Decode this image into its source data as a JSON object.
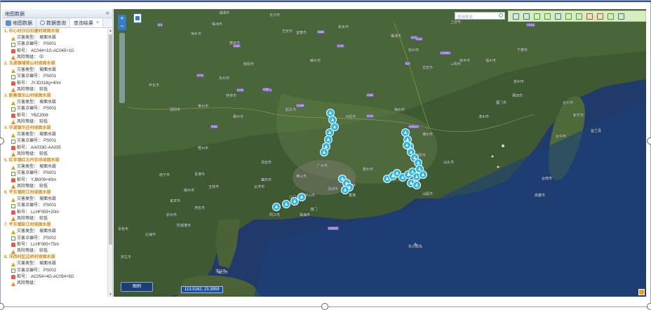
{
  "panel": {
    "title": "地图数据",
    "collapse_glyph": "«",
    "tabs": [
      {
        "label": "地图数据",
        "icon": "map-icon"
      },
      {
        "label": "数据查询",
        "icon": "search-icon"
      },
      {
        "label": "查询结果",
        "close": "×"
      }
    ],
    "results": [
      {
        "title": "1. 中心村沙白石塘村坡面水毁",
        "type_label": "灾害类型：",
        "type": "坡面水毁",
        "no_label": "灾害点编号：",
        "no": "PS001",
        "pile_label": "桩号：",
        "pile": "AC044+1G-AC045+1G",
        "risk_label": "风险等级：",
        "risk": "中"
      },
      {
        "title": "2. 玉湖镇埔背山村坡面水毁",
        "type_label": "灾害类型：",
        "type": "坡面水毁",
        "no_label": "灾害点编号：",
        "no": "PS001",
        "pile_label": "桩号：",
        "pile": "JYJD318g+40m",
        "risk_label": "风险等级：",
        "risk": "较低"
      },
      {
        "title": "3. 新蕉镇东山村坡面水毁",
        "type_label": "灾害类型：",
        "type": "坡面水毁",
        "no_label": "灾害点编号：",
        "no": "PS001",
        "pile_label": "桩号：",
        "pile": "YBZJ006",
        "risk_label": "风险等级：",
        "risk": "较低"
      },
      {
        "title": "4. 华湖镇华庄村坡面水毁",
        "type_label": "灾害类型：",
        "type": "坡面水毁",
        "no_label": "灾害点编号：",
        "no": "PS001",
        "pile_label": "桩号：",
        "pile": "AA033G-AA035",
        "risk_label": "风险等级：",
        "risk": "较低"
      },
      {
        "title": "5. 红丰镇红五丹农场坡面水毁",
        "type_label": "灾害类型：",
        "type": "坡面水毁",
        "no_label": "灾害点编号：",
        "no": "PS001",
        "pile_label": "桩号：",
        "pile": "YJB009+40m",
        "risk_label": "风险等级：",
        "risk": "较低"
      },
      {
        "title": "6. 平东镇阳江村坡面水毁",
        "type_label": "灾害类型：",
        "type": "坡面水毁",
        "no_label": "灾害点编号：",
        "no": "PS001",
        "pile_label": "桩号：",
        "pile": "LLHF059+20m",
        "risk_label": "风险等级：",
        "risk": "较低"
      },
      {
        "title": "7. 平东镇阳江村坡面水毁",
        "type_label": "灾害类型：",
        "type": "坡面水毁",
        "no_label": "灾害点编号：",
        "no": "PS002",
        "pile_label": "桩号：",
        "pile": "LLHF065+75m",
        "risk_label": "风险等级：",
        "risk": "较低"
      },
      {
        "title": "8. 洋西村区边桥村坡面水毁",
        "type_label": "灾害类型：",
        "type": "坡面水毁",
        "no_label": "灾害点编号：",
        "no": "PS002",
        "pile_label": "桩号：",
        "pile": "AC054+4G-AC054+5G",
        "risk_label": "风险等级：",
        "risk": ""
      }
    ]
  },
  "map": {
    "zoom_in": "+",
    "zoom_out": "−",
    "search_placeholder": "查询地名",
    "coords": "113.5162, 23.3959",
    "legend_label": "图例",
    "tools": [
      "full-extent-icon",
      "refresh-icon",
      "select-icon",
      "clear-icon",
      "print-icon",
      "measure-line-icon",
      "measure-area-icon",
      "chart-icon",
      "erase-icon",
      "draw-icon",
      "save-icon"
    ],
    "cities": [
      {
        "name": "湘潭市"
      },
      {
        "name": "株洲市"
      },
      {
        "name": "萍乡市"
      },
      {
        "name": "吉安市"
      },
      {
        "name": "赣州市"
      },
      {
        "name": "衡阳市"
      },
      {
        "name": "永州市"
      },
      {
        "name": "郴州市"
      },
      {
        "name": "桂林市"
      },
      {
        "name": "韶关市"
      },
      {
        "name": "河源市"
      },
      {
        "name": "梅州市"
      },
      {
        "name": "龙岩市"
      },
      {
        "name": "三明市"
      },
      {
        "name": "福州市"
      },
      {
        "name": "泉州市"
      },
      {
        "name": "厦门市"
      },
      {
        "name": "漳州市"
      },
      {
        "name": "汕头市"
      },
      {
        "name": "潮州市"
      },
      {
        "name": "揭阳市"
      },
      {
        "name": "汕尾市"
      },
      {
        "name": "惠州市"
      },
      {
        "name": "广州市"
      },
      {
        "name": "东莞市"
      },
      {
        "name": "深圳市"
      },
      {
        "name": "香港"
      },
      {
        "name": "澳门"
      },
      {
        "name": "佛山市"
      },
      {
        "name": "肇庆市"
      },
      {
        "name": "云浮市"
      },
      {
        "name": "清远市"
      },
      {
        "name": "贺州市"
      },
      {
        "name": "梧州市"
      },
      {
        "name": "玉林市"
      },
      {
        "name": "贵港市"
      },
      {
        "name": "南宁市"
      },
      {
        "name": "钦州市"
      },
      {
        "name": "北海市"
      },
      {
        "name": "防城港市"
      },
      {
        "name": "湛江市"
      },
      {
        "name": "茂名市"
      },
      {
        "name": "阳江市"
      },
      {
        "name": "江门市"
      },
      {
        "name": "中山市"
      },
      {
        "name": "珠海市"
      },
      {
        "name": "海口市"
      },
      {
        "name": "台北市"
      },
      {
        "name": "台中市"
      },
      {
        "name": "台南市"
      },
      {
        "name": "高雄市"
      },
      {
        "name": "东沙群岛"
      },
      {
        "name": "莆田市"
      },
      {
        "name": "宁德市"
      },
      {
        "name": "南平市"
      },
      {
        "name": "上饶市"
      },
      {
        "name": "抚州市"
      },
      {
        "name": "新余市"
      },
      {
        "name": "宜春市"
      },
      {
        "name": "长沙市"
      },
      {
        "name": "怀化市"
      },
      {
        "name": "邵阳市"
      },
      {
        "name": "柳州市"
      },
      {
        "name": "来宾市"
      },
      {
        "name": "百色市"
      },
      {
        "name": "崇左市"
      },
      {
        "name": "宜兰县"
      },
      {
        "name": "鹰潭市"
      },
      {
        "name": "娄底市"
      },
      {
        "name": "新竹市"
      }
    ],
    "highways": [
      "G4",
      "G60",
      "G65",
      "G72",
      "G75",
      "G78",
      "G80",
      "G76",
      "G45",
      "G70",
      "G15",
      "G3",
      "G1501",
      "G25",
      "G35",
      "G4W",
      "G0421",
      "G0422",
      "G94",
      "G15"
    ],
    "marker_count": 33
  }
}
